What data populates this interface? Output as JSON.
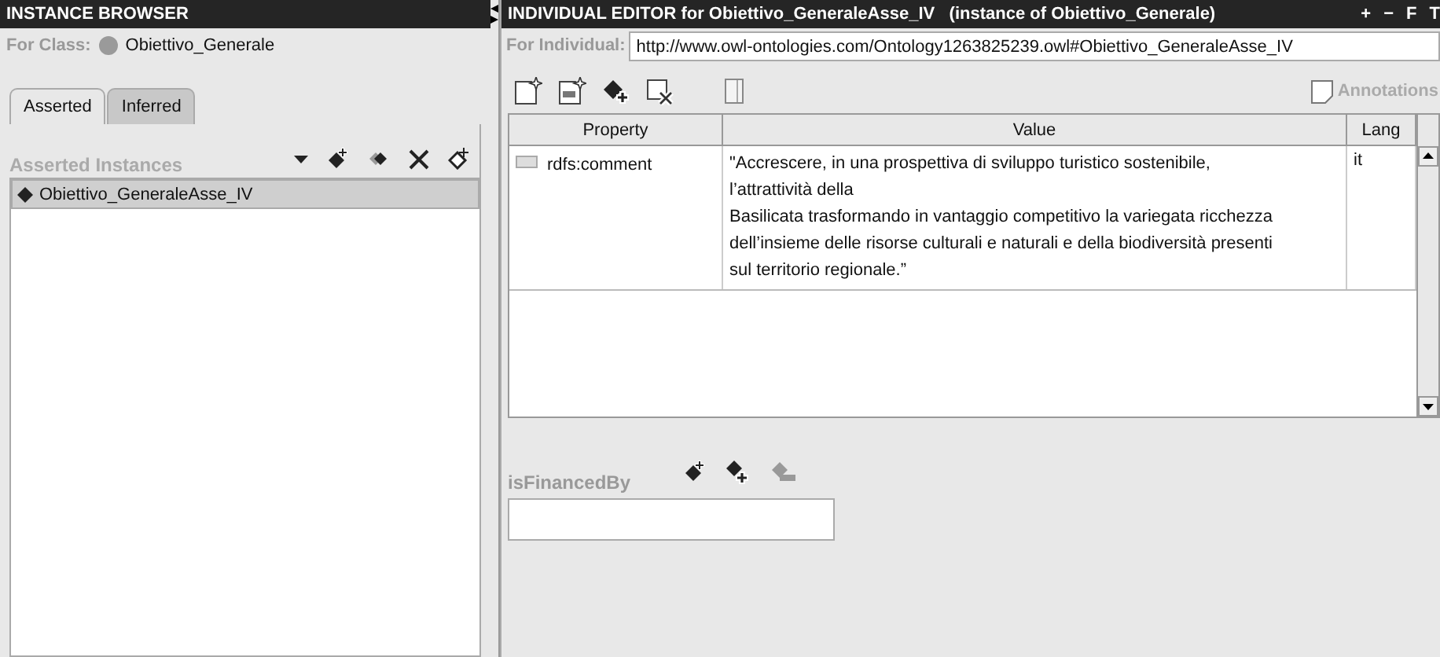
{
  "instance_browser": {
    "title": "INSTANCE BROWSER",
    "for_class_label": "For Class:",
    "for_class": "Obiettivo_Generale",
    "tabs": [
      {
        "label": "Asserted",
        "selected": true
      },
      {
        "label": "Inferred",
        "selected": false
      }
    ],
    "list_title": "Asserted Instances",
    "instances": [
      {
        "label": "Obiettivo_GeneraleAsse_IV",
        "selected": true
      }
    ]
  },
  "individual_editor": {
    "title": "INDIVIDUAL EDITOR for Obiettivo_GeneraleAsse_IV   (instance of Obiettivo_Generale)",
    "title_buttons": [
      "+",
      "−",
      "F",
      "T"
    ],
    "for_individual_label": "For Individual:",
    "for_individual": "http://www.owl-ontologies.com/Ontology1263825239.owl#Obiettivo_GeneraleAsse_IV",
    "annotations_label": "Annotations",
    "table": {
      "columns": [
        "Property",
        "Value",
        "Lang"
      ],
      "rows": [
        {
          "property": "rdfs:comment",
          "value_lines": [
            "\"Accrescere, in una prospettiva di sviluppo turistico sostenibile,",
            "l’attrattività della",
            "Basilicata trasformando in vantaggio competitivo la variegata ricchezza",
            "dell’insieme delle risorse culturali e naturali e della biodiversità presenti",
            "sul territorio regionale.”"
          ],
          "lang": "it"
        }
      ]
    },
    "property_slot": {
      "label": "isFinancedBy"
    }
  }
}
